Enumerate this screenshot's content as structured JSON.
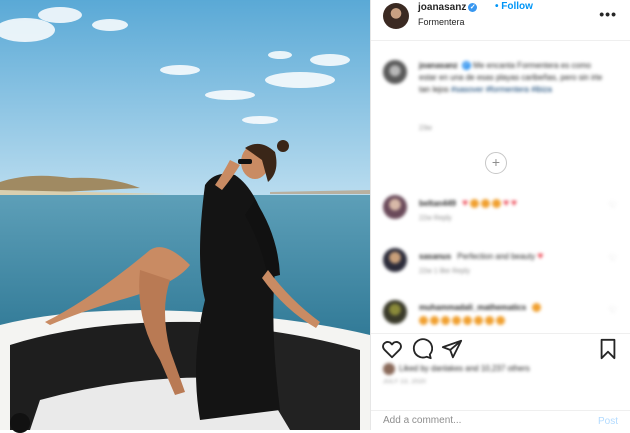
{
  "header": {
    "username": "joanasanz",
    "follow_label": "Follow",
    "location": "Formentera",
    "more_glyph": "•••"
  },
  "caption": {
    "username": "joanasanz",
    "text": "Me encanta Formentera es como estar en una de esas playas caribeñas, pero sin irte tan lejos",
    "tags": "#sasover #formentera #ibiza",
    "time": "23w"
  },
  "comments": [
    {
      "username": "beltan449",
      "text": "",
      "meta": "22w  Reply",
      "emoji_colors": [
        "#ed4956",
        "#f0a030",
        "#f0a030",
        "#f0a030",
        "#ed4956",
        "#ed4956"
      ]
    },
    {
      "username": "sasanus",
      "text": "Perfection and beauty",
      "meta": "22w  1 like  Reply",
      "emoji_colors": [
        "#ed4956"
      ]
    },
    {
      "username": "muhammadali_mathematics",
      "text": "",
      "meta": "",
      "emoji_colors": [
        "#f0a030",
        "#f0a030",
        "#f0a030",
        "#f0a030",
        "#f0a030",
        "#f0a030",
        "#f0a030",
        "#f0a030"
      ]
    }
  ],
  "actions": {
    "likes_text": "Liked by danlakes and 10,237 others",
    "date": "JULY 13, 2020"
  },
  "add_comment": {
    "placeholder": "Add a comment...",
    "post_label": "Post"
  },
  "colors": {
    "accent": "#0095f6",
    "verified": "#3897f0",
    "sky": "#8ec6e6",
    "sea": "#3e8aa8"
  },
  "icons": [
    "heart-icon",
    "comment-icon",
    "share-icon",
    "bookmark-icon",
    "plus-circle-icon",
    "verified-icon",
    "more-icon"
  ]
}
